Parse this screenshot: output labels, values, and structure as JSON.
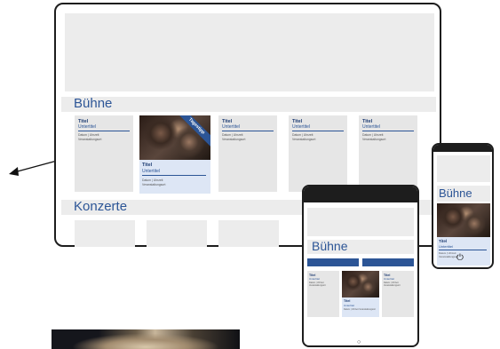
{
  "desktop": {
    "buehne_label": "Bühne",
    "konzerte_label": "Konzerte",
    "cards": [
      {
        "title": "Titel",
        "subtitle": "Untertitel",
        "meta1": "Datum | Uhrzeit",
        "meta2": "Veranstaltungsort"
      },
      {
        "title": "Titel",
        "subtitle": "Untertitel",
        "meta1": "Datum | Uhrzeit",
        "meta2": "Veranstaltungsort"
      },
      {
        "title": "Titel",
        "subtitle": "Untertitel",
        "meta1": "Datum | Uhrzeit",
        "meta2": "Veranstaltungsort"
      },
      {
        "title": "Titel",
        "subtitle": "Untertitel",
        "meta1": "Datum | Uhrzeit",
        "meta2": "Veranstaltungsort"
      }
    ],
    "featured": {
      "ribbon": "Tagestipp",
      "title": "Titel",
      "subtitle": "Untertitel",
      "meta1": "Datum | Uhrzeit",
      "meta2": "Veranstaltungsort"
    }
  },
  "tablet": {
    "buehne_label": "Bühne",
    "card_left": {
      "title": "Titel",
      "subtitle": "Untertitel",
      "meta": "Datum | Uhrzeit Veranstaltungsort"
    },
    "card_right": {
      "title": "Titel",
      "subtitle": "Untertitel",
      "meta": "Datum | Uhrzeit Veranstaltungsort"
    },
    "featured": {
      "title": "Titel",
      "subtitle": "Untertitel",
      "meta": "Datum | Uhrzeit Veranstaltungsort"
    }
  },
  "phone": {
    "buehne_label": "Bühne",
    "featured": {
      "title": "Titel",
      "subtitle": "Untertitel",
      "meta1": "Datum | Uhrzeit",
      "meta2": "Veranstaltungsort"
    }
  },
  "colors": {
    "accent": "#2c5596",
    "frame": "#1d1d1d",
    "panel": "#ececec"
  },
  "icons": {
    "arrow": "arrow-icon",
    "power": "power-icon"
  }
}
